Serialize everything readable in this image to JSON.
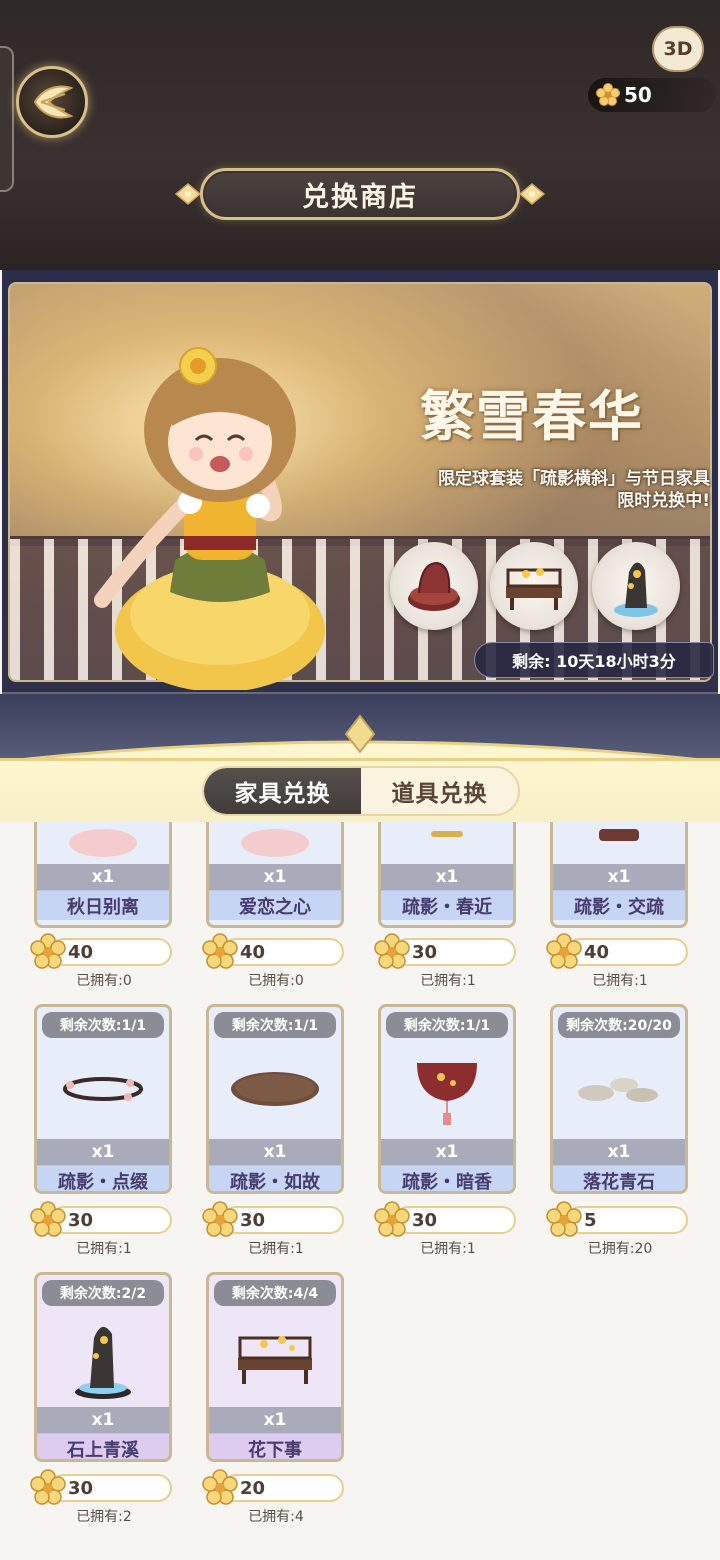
{
  "header": {
    "title": "兑换商店",
    "currency_value": "50",
    "currency_icon": "flower-currency-icon",
    "back_icon": "wing-back-icon"
  },
  "banner": {
    "badge": "3D",
    "title": "繁雪春华",
    "subtitle_line1": "限定球套装「疏影横斜」与节日家具",
    "subtitle_line2": "限时兑换中!",
    "timer": "剩余: 10天18小时3分"
  },
  "tabs": [
    {
      "label": "家具兑换",
      "active": true
    },
    {
      "label": "道具兑换",
      "active": false
    }
  ],
  "colors": {
    "accent_gold": "#e7cf8c",
    "card_blue": "#c7d5f4",
    "card_purple": "#ddcbf0",
    "dark_tab": "#4a4543"
  },
  "items": [
    {
      "name": "秋日别离",
      "qty": "x1",
      "price": "40",
      "owned": "已拥有:0",
      "remaining": "",
      "tier": "blue"
    },
    {
      "name": "爱恋之心",
      "qty": "x1",
      "price": "40",
      "owned": "已拥有:0",
      "remaining": "",
      "tier": "blue"
    },
    {
      "name": "疏影・春近",
      "qty": "x1",
      "price": "30",
      "owned": "已拥有:1",
      "remaining": "",
      "tier": "blue"
    },
    {
      "name": "疏影・交疏",
      "qty": "x1",
      "price": "40",
      "owned": "已拥有:1",
      "remaining": "",
      "tier": "blue"
    },
    {
      "name": "疏影・点缀",
      "qty": "x1",
      "price": "30",
      "owned": "已拥有:1",
      "remaining": "剩余次数:1/1",
      "tier": "blue"
    },
    {
      "name": "疏影・如故",
      "qty": "x1",
      "price": "30",
      "owned": "已拥有:1",
      "remaining": "剩余次数:1/1",
      "tier": "blue"
    },
    {
      "name": "疏影・暗香",
      "qty": "x1",
      "price": "30",
      "owned": "已拥有:1",
      "remaining": "剩余次数:1/1",
      "tier": "blue"
    },
    {
      "name": "落花青石",
      "qty": "x1",
      "price": "5",
      "owned": "已拥有:20",
      "remaining": "剩余次数:20/20",
      "tier": "blue"
    },
    {
      "name": "石上青溪",
      "qty": "x1",
      "price": "30",
      "owned": "已拥有:2",
      "remaining": "剩余次数:2/2",
      "tier": "purple"
    },
    {
      "name": "花下事",
      "qty": "x1",
      "price": "20",
      "owned": "已拥有:4",
      "remaining": "剩余次数:4/4",
      "tier": "purple"
    }
  ]
}
